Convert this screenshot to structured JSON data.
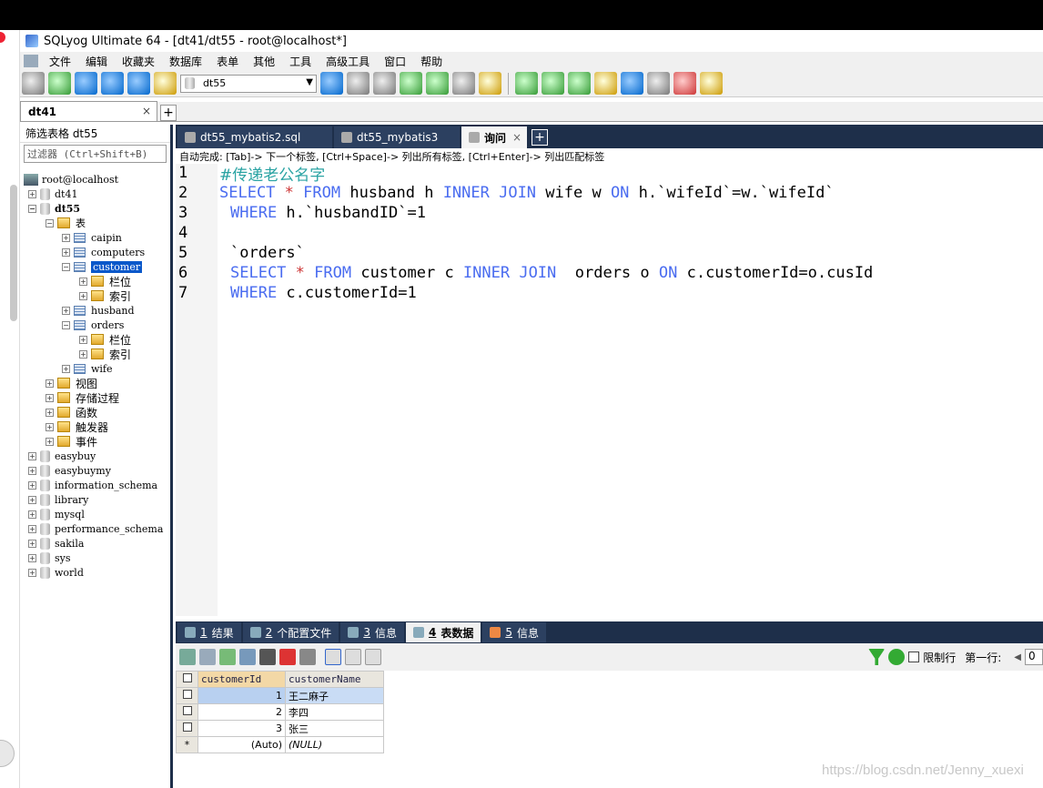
{
  "window": {
    "title": "SQLyog Ultimate 64 - [dt41/dt55 - root@localhost*]"
  },
  "menu": [
    "文件",
    "编辑",
    "收藏夹",
    "数据库",
    "表单",
    "其他",
    "工具",
    "高级工具",
    "窗口",
    "帮助"
  ],
  "toolbar": {
    "db_select": "dt55"
  },
  "connection_tab": {
    "label": "dt41",
    "close": "×"
  },
  "left_panel": {
    "filter_label": "筛选表格  dt55",
    "filter_placeholder": "过滤器 (Ctrl+Shift+B)",
    "tree": {
      "root": "root@localhost",
      "dt41": "dt41",
      "dt55": "dt55",
      "tables_folder": "表",
      "tables": [
        "caipin",
        "computers",
        "customer",
        "husband",
        "orders",
        "wife"
      ],
      "columns": "栏位",
      "indexes": "索引",
      "views": "视图",
      "procs": "存储过程",
      "funcs": "函数",
      "triggers": "触发器",
      "events": "事件",
      "other_dbs": [
        "easybuy",
        "easybuymy",
        "information_schema",
        "library",
        "mysql",
        "performance_schema",
        "sakila",
        "sys",
        "world"
      ]
    }
  },
  "editor_tabs": [
    {
      "label": "dt55_mybatis2.sql"
    },
    {
      "label": "dt55_mybatis3"
    },
    {
      "label": "询问",
      "active": true,
      "close": "×"
    }
  ],
  "hint": "自动完成: [Tab]-> 下一个标签, [Ctrl+Space]-> 列出所有标签, [Ctrl+Enter]-> 列出匹配标签",
  "editor": {
    "line_numbers": [
      "1",
      "2",
      "3",
      "4",
      "5",
      "6",
      "7"
    ],
    "lines": {
      "l1": "#传递老公名字",
      "l2": {
        "a": "SELECT",
        "b": " * ",
        "c": "FROM",
        "d": " husband h ",
        "e": "INNER JOIN",
        "f": " wife w ",
        "g": "ON",
        "h": " h.`wifeId`=w.`wifeId`"
      },
      "l3": {
        "a": "WHERE",
        "b": " h.`husbandID`=1"
      },
      "l5": "`orders`",
      "l6": {
        "a": "SELECT",
        "b": " * ",
        "c": "FROM",
        "d": " customer c ",
        "e": "INNER JOIN",
        "f": "  orders o ",
        "g": "ON",
        "h": " c.customerId=o.cusId"
      },
      "l7": {
        "a": "WHERE",
        "b": " c.customerId=1"
      }
    }
  },
  "result_tabs": [
    {
      "num": "1",
      "label": "结果"
    },
    {
      "num": "2",
      "label": "个配置文件"
    },
    {
      "num": "3",
      "label": "信息"
    },
    {
      "num": "4",
      "label": "表数据",
      "active": true
    },
    {
      "num": "5",
      "label": "信息"
    }
  ],
  "result_toolbar": {
    "limit_label": "限制行",
    "first_row_label": "第一行:",
    "first_row_value": "0"
  },
  "grid": {
    "columns": [
      "customerId",
      "customerName"
    ],
    "rows": [
      {
        "id": "1",
        "name": "王二麻子"
      },
      {
        "id": "2",
        "name": "李四"
      },
      {
        "id": "3",
        "name": "张三"
      },
      {
        "id": "(Auto)",
        "name": "(NULL)"
      }
    ]
  },
  "watermark": "https://blog.csdn.net/Jenny_xuexi",
  "colors": {
    "dark_panel": "#1e2f4a",
    "keyword": "#4a6cf0",
    "comment": "#2aa3a3",
    "selected": "#0a58ca"
  }
}
